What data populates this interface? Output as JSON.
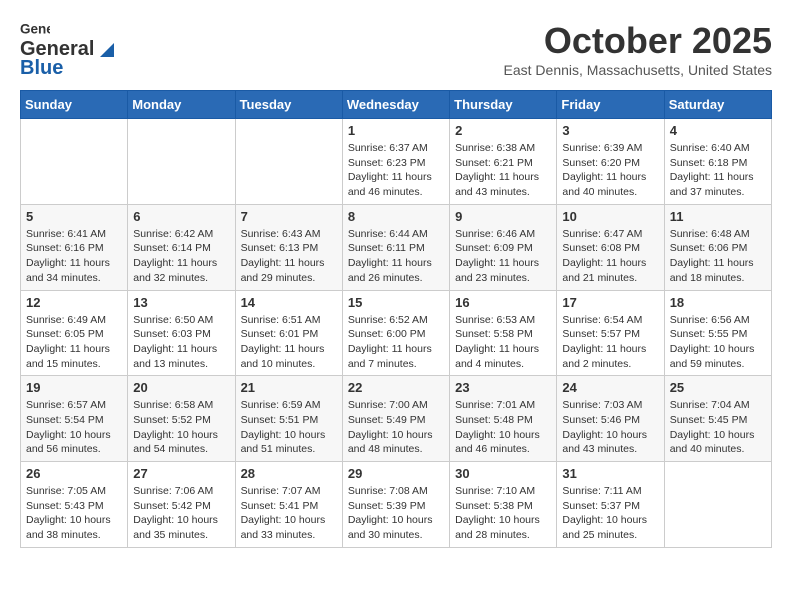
{
  "header": {
    "logo": {
      "general": "General",
      "blue": "Blue"
    },
    "title": "October 2025",
    "location": "East Dennis, Massachusetts, United States"
  },
  "weekdays": [
    "Sunday",
    "Monday",
    "Tuesday",
    "Wednesday",
    "Thursday",
    "Friday",
    "Saturday"
  ],
  "weeks": [
    [
      {
        "day": "",
        "info": ""
      },
      {
        "day": "",
        "info": ""
      },
      {
        "day": "",
        "info": ""
      },
      {
        "day": "1",
        "info": "Sunrise: 6:37 AM\nSunset: 6:23 PM\nDaylight: 11 hours\nand 46 minutes."
      },
      {
        "day": "2",
        "info": "Sunrise: 6:38 AM\nSunset: 6:21 PM\nDaylight: 11 hours\nand 43 minutes."
      },
      {
        "day": "3",
        "info": "Sunrise: 6:39 AM\nSunset: 6:20 PM\nDaylight: 11 hours\nand 40 minutes."
      },
      {
        "day": "4",
        "info": "Sunrise: 6:40 AM\nSunset: 6:18 PM\nDaylight: 11 hours\nand 37 minutes."
      }
    ],
    [
      {
        "day": "5",
        "info": "Sunrise: 6:41 AM\nSunset: 6:16 PM\nDaylight: 11 hours\nand 34 minutes."
      },
      {
        "day": "6",
        "info": "Sunrise: 6:42 AM\nSunset: 6:14 PM\nDaylight: 11 hours\nand 32 minutes."
      },
      {
        "day": "7",
        "info": "Sunrise: 6:43 AM\nSunset: 6:13 PM\nDaylight: 11 hours\nand 29 minutes."
      },
      {
        "day": "8",
        "info": "Sunrise: 6:44 AM\nSunset: 6:11 PM\nDaylight: 11 hours\nand 26 minutes."
      },
      {
        "day": "9",
        "info": "Sunrise: 6:46 AM\nSunset: 6:09 PM\nDaylight: 11 hours\nand 23 minutes."
      },
      {
        "day": "10",
        "info": "Sunrise: 6:47 AM\nSunset: 6:08 PM\nDaylight: 11 hours\nand 21 minutes."
      },
      {
        "day": "11",
        "info": "Sunrise: 6:48 AM\nSunset: 6:06 PM\nDaylight: 11 hours\nand 18 minutes."
      }
    ],
    [
      {
        "day": "12",
        "info": "Sunrise: 6:49 AM\nSunset: 6:05 PM\nDaylight: 11 hours\nand 15 minutes."
      },
      {
        "day": "13",
        "info": "Sunrise: 6:50 AM\nSunset: 6:03 PM\nDaylight: 11 hours\nand 13 minutes."
      },
      {
        "day": "14",
        "info": "Sunrise: 6:51 AM\nSunset: 6:01 PM\nDaylight: 11 hours\nand 10 minutes."
      },
      {
        "day": "15",
        "info": "Sunrise: 6:52 AM\nSunset: 6:00 PM\nDaylight: 11 hours\nand 7 minutes."
      },
      {
        "day": "16",
        "info": "Sunrise: 6:53 AM\nSunset: 5:58 PM\nDaylight: 11 hours\nand 4 minutes."
      },
      {
        "day": "17",
        "info": "Sunrise: 6:54 AM\nSunset: 5:57 PM\nDaylight: 11 hours\nand 2 minutes."
      },
      {
        "day": "18",
        "info": "Sunrise: 6:56 AM\nSunset: 5:55 PM\nDaylight: 10 hours\nand 59 minutes."
      }
    ],
    [
      {
        "day": "19",
        "info": "Sunrise: 6:57 AM\nSunset: 5:54 PM\nDaylight: 10 hours\nand 56 minutes."
      },
      {
        "day": "20",
        "info": "Sunrise: 6:58 AM\nSunset: 5:52 PM\nDaylight: 10 hours\nand 54 minutes."
      },
      {
        "day": "21",
        "info": "Sunrise: 6:59 AM\nSunset: 5:51 PM\nDaylight: 10 hours\nand 51 minutes."
      },
      {
        "day": "22",
        "info": "Sunrise: 7:00 AM\nSunset: 5:49 PM\nDaylight: 10 hours\nand 48 minutes."
      },
      {
        "day": "23",
        "info": "Sunrise: 7:01 AM\nSunset: 5:48 PM\nDaylight: 10 hours\nand 46 minutes."
      },
      {
        "day": "24",
        "info": "Sunrise: 7:03 AM\nSunset: 5:46 PM\nDaylight: 10 hours\nand 43 minutes."
      },
      {
        "day": "25",
        "info": "Sunrise: 7:04 AM\nSunset: 5:45 PM\nDaylight: 10 hours\nand 40 minutes."
      }
    ],
    [
      {
        "day": "26",
        "info": "Sunrise: 7:05 AM\nSunset: 5:43 PM\nDaylight: 10 hours\nand 38 minutes."
      },
      {
        "day": "27",
        "info": "Sunrise: 7:06 AM\nSunset: 5:42 PM\nDaylight: 10 hours\nand 35 minutes."
      },
      {
        "day": "28",
        "info": "Sunrise: 7:07 AM\nSunset: 5:41 PM\nDaylight: 10 hours\nand 33 minutes."
      },
      {
        "day": "29",
        "info": "Sunrise: 7:08 AM\nSunset: 5:39 PM\nDaylight: 10 hours\nand 30 minutes."
      },
      {
        "day": "30",
        "info": "Sunrise: 7:10 AM\nSunset: 5:38 PM\nDaylight: 10 hours\nand 28 minutes."
      },
      {
        "day": "31",
        "info": "Sunrise: 7:11 AM\nSunset: 5:37 PM\nDaylight: 10 hours\nand 25 minutes."
      },
      {
        "day": "",
        "info": ""
      }
    ]
  ]
}
